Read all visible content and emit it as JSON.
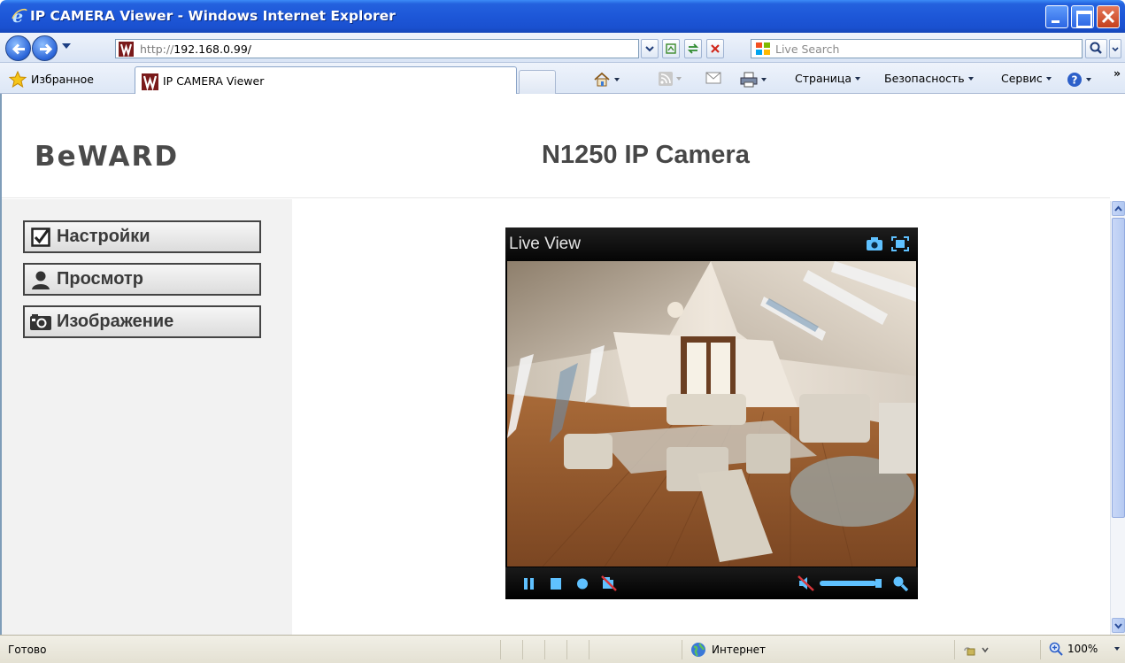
{
  "window": {
    "title": "IP CAMERA Viewer - Windows Internet Explorer"
  },
  "address_bar": {
    "url_protocol": "http://",
    "url_host": "192.168.0.99/",
    "search_placeholder": "Live Search"
  },
  "favorites_bar": {
    "favorites_label": "Избранное",
    "tab_title": "IP CAMERA Viewer",
    "commands": {
      "page": "Страница",
      "safety": "Безопасность",
      "tools": "Сервис"
    }
  },
  "page": {
    "brand": "BeWARD",
    "camera_title": "N1250 IP Camera",
    "menu": [
      {
        "label": "Настройки",
        "icon": "checkbox-icon"
      },
      {
        "label": "Просмотр",
        "icon": "person-icon"
      },
      {
        "label": "Изображение",
        "icon": "camera-icon"
      }
    ],
    "viewer": {
      "title": "Live View",
      "top_icons": [
        "snapshot-icon",
        "fullscreen-icon"
      ],
      "controls": [
        "pause-icon",
        "stop-icon",
        "record-icon",
        "mute-video-icon",
        "speaker-muted-icon",
        "volume-slider",
        "zoom-icon"
      ]
    }
  },
  "status_bar": {
    "status": "Готово",
    "zone": "Интернет",
    "zoom": "100%"
  },
  "colors": {
    "titlebar": "#1d57d8",
    "sidebar_bg": "#f2f2f2",
    "viewer_bg": "#000000",
    "accent_icon": "#5fc1ff"
  }
}
